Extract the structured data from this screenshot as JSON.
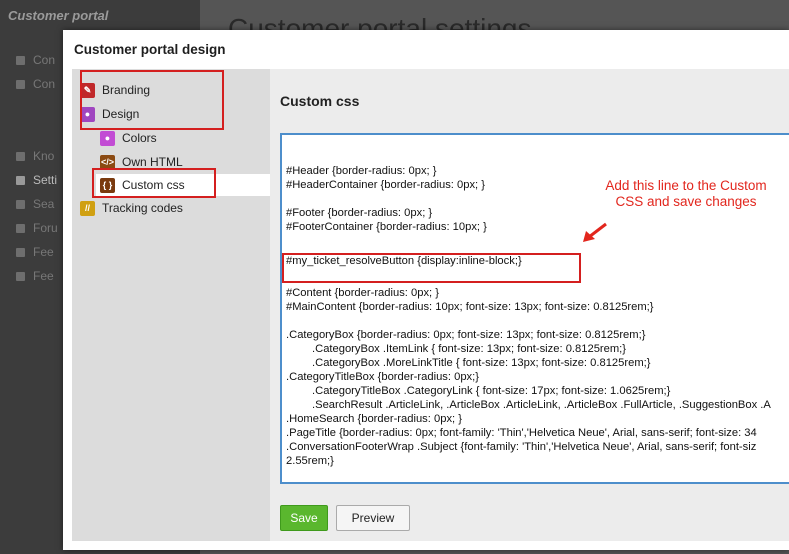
{
  "background": {
    "app_title": "Customer portal",
    "page_title": "Customer portal settings",
    "menu_items": [
      "Con",
      "Con",
      "Kno",
      "Setti",
      "Sea",
      "Foru",
      "Fee",
      "Fee"
    ]
  },
  "dialog": {
    "title": "Customer portal design",
    "nav": {
      "branding": "Branding",
      "design": "Design",
      "colors": "Colors",
      "own_html": "Own HTML",
      "custom_css": "Custom css",
      "tracking": "Tracking codes"
    },
    "content_title": "Custom css",
    "css_lines": [
      "#Header {border-radius: 0px;  }",
      "#HeaderContainer {border-radius: 0px;  }",
      "#Footer {border-radius: 0px;  }",
      "#FooterContainer {border-radius: 10px;  }",
      "#my_ticket_resolveButton {display:inline-block;}",
      "#Content {border-radius: 0px; }",
      "#MainContent {border-radius: 10px;  font-size: 13px; font-size: 0.8125rem;}",
      ".CategoryBox {border-radius: 0px;  font-size: 13px; font-size: 0.8125rem;}",
      ".CategoryBox .ItemLink {  font-size: 13px; font-size: 0.8125rem;}",
      ".CategoryBox .MoreLinkTitle {  font-size: 13px; font-size: 0.8125rem;}",
      ".CategoryTitleBox {border-radius: 0px;}",
      ".CategoryTitleBox .CategoryLink { font-size: 17px; font-size: 1.0625rem;}",
      ".SearchResult .ArticleLink, .ArticleBox .ArticleLink, .ArticleBox .FullArticle, .SuggestionBox .A",
      ".HomeSearch {border-radius: 0px;  }",
      ".PageTitle {border-radius: 0px; font-family: 'Thin','Helvetica Neue', Arial, sans-serif; font-size: 34",
      ".ConversationFooterWrap .Subject {font-family: 'Thin','Helvetica Neue', Arial, sans-serif; font-siz",
      "2.55rem;}"
    ],
    "annotation": "Add this line to the Custom CSS and save changes",
    "save_label": "Save",
    "preview_label": "Preview"
  },
  "colors": {
    "accent_blue": "#4d8ecb",
    "highlight_red": "#d41f1f",
    "save_green": "#5ab72e"
  }
}
